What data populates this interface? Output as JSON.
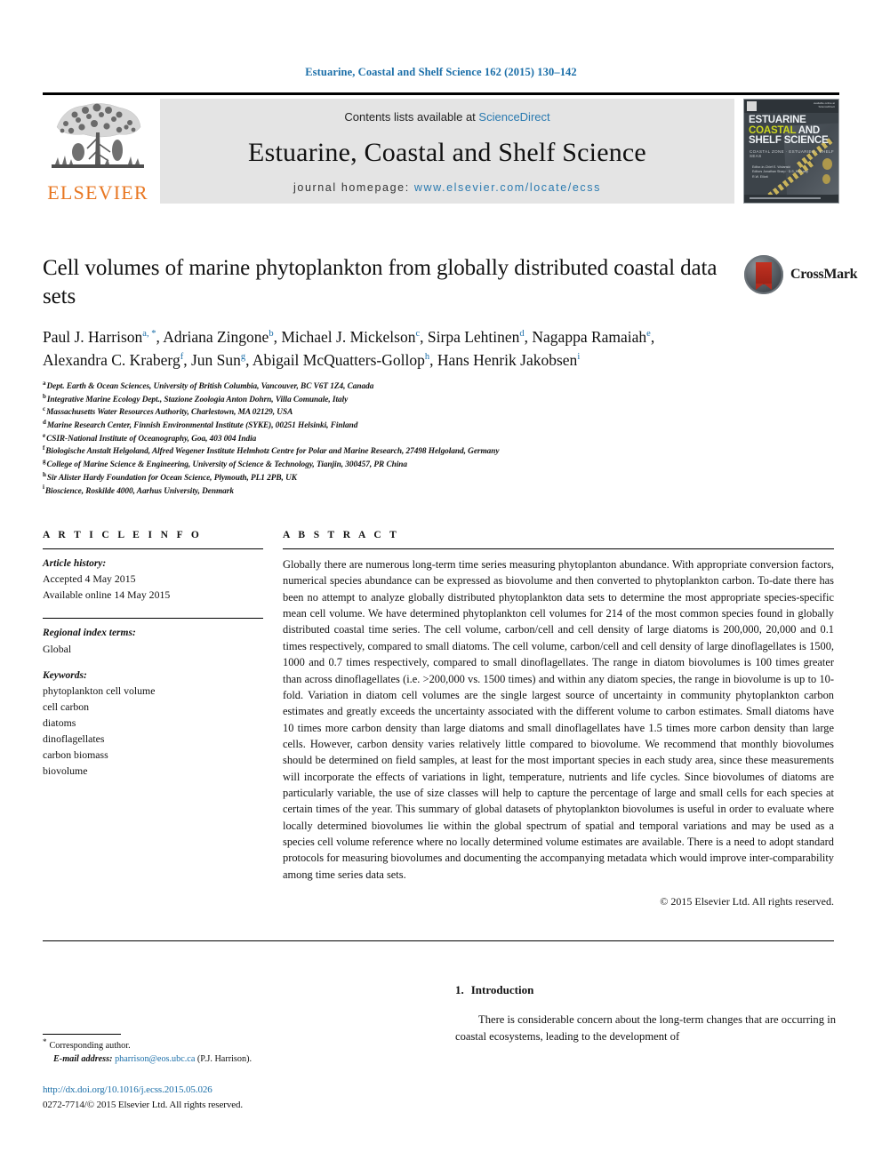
{
  "running_head": "Estuarine, Coastal and Shelf Science 162 (2015) 130–142",
  "masthead": {
    "contents_prefix": "Contents lists available at",
    "sciencedirect": "ScienceDirect",
    "journal_name": "Estuarine, Coastal and Shelf Science",
    "homepage_prefix": "journal homepage:",
    "homepage_url": "www.elsevier.com/locate/ecss",
    "publisher_logo_text": "ELSEVIER",
    "link_color": "#2a7ab0",
    "elsevier_orange": "#e87722",
    "cover": {
      "line1": "ESTUARINE",
      "line2a": "COASTAL",
      "line2b": "AND",
      "line3": "SHELF SCIENCE",
      "subtitle": "COASTAL ZONE · ESTUARIES · SHELF SEAS",
      "editors": "Editor-in-Chief  E. Wolanski\nEditors  Jonathan Sharp · D.S. McLusky\nR.W. Elliott",
      "top_note": "available online at\nScienceDirect"
    }
  },
  "article": {
    "title": "Cell volumes of marine phytoplankton from globally distributed coastal data sets",
    "authors_line1": "Paul J. Harrison ",
    "authors": [
      {
        "name": "Paul J. Harrison",
        "marks": "a, *",
        "sep": ", "
      },
      {
        "name": "Adriana Zingone",
        "marks": "b",
        "sep": ", "
      },
      {
        "name": "Michael J. Mickelson",
        "marks": "c",
        "sep": ", "
      },
      {
        "name": "Sirpa Lehtinen",
        "marks": "d",
        "sep": ","
      },
      {
        "name": "Nagappa Ramaiah",
        "marks": "e",
        "sep": ", "
      },
      {
        "name": "Alexandra C. Kraberg",
        "marks": "f",
        "sep": ", "
      },
      {
        "name": "Jun Sun",
        "marks": "g",
        "sep": ", "
      },
      {
        "name": "Abigail McQuatters-Gollop",
        "marks": "h",
        "sep": ","
      },
      {
        "name": "Hans Henrik Jakobsen",
        "marks": "i",
        "sep": ""
      }
    ],
    "crossmark_label": "CrossMark"
  },
  "affiliations": [
    {
      "mark": "a",
      "text": "Dept. Earth & Ocean Sciences, University of British Columbia, Vancouver, BC V6T 1Z4, Canada"
    },
    {
      "mark": "b",
      "text": "Integrative Marine Ecology Dept., Stazione Zoologia Anton Dohrn, Villa Comunale, Italy"
    },
    {
      "mark": "c",
      "text": "Massachusetts Water Resources Authority, Charlestown, MA 02129, USA"
    },
    {
      "mark": "d",
      "text": "Marine Research Center, Finnish Environmental Institute (SYKE), 00251 Helsinki, Finland"
    },
    {
      "mark": "e",
      "text": "CSIR-National Institute of Oceanography, Goa, 403 004 India"
    },
    {
      "mark": "f",
      "text": "Biologische Anstalt Helgoland, Alfred Wegener Institute Helmhotz Centre for Polar and Marine Research, 27498 Helgoland, Germany"
    },
    {
      "mark": "g",
      "text": "College of Marine Science & Engineering, University of Science & Technology, Tianjin, 300457, PR China"
    },
    {
      "mark": "h",
      "text": "Sir Alister Hardy Foundation for Ocean Science, Plymouth, PL1 2PB, UK"
    },
    {
      "mark": "i",
      "text": "Bioscience, Roskilde 4000, Aarhus University, Denmark"
    }
  ],
  "article_info": {
    "heading": "A R T I C L E   I N F O",
    "history_label": "Article history:",
    "history_lines": [
      "Accepted 4 May 2015",
      "Available online 14 May 2015"
    ],
    "regional_label": "Regional index terms:",
    "regional_values": [
      "Global"
    ],
    "keywords_label": "Keywords:",
    "keywords": [
      "phytoplankton cell volume",
      "cell carbon",
      "diatoms",
      "dinoflagellates",
      "carbon biomass",
      "biovolume"
    ]
  },
  "abstract": {
    "heading": "A B S T R A C T",
    "text": "Globally there are numerous long-term time series measuring phytoplanton abundance. With appropriate conversion factors, numerical species abundance can be expressed as biovolume and then converted to phytoplankton carbon. To-date there has been no attempt to analyze globally distributed phytoplankton data sets to determine the most appropriate species-specific mean cell volume. We have determined phytoplankton cell volumes for 214 of the most common species found in globally distributed coastal time series. The cell volume, carbon/cell and cell density of large diatoms is 200,000, 20,000 and 0.1 times respectively, compared to small diatoms. The cell volume, carbon/cell and cell density of large dinoflagellates is 1500, 1000 and 0.7 times respectively, compared to small dinoflagellates. The range in diatom biovolumes is 100 times greater than across dinoflagellates (i.e. >200,000 vs. 1500 times) and within any diatom species, the range in biovolume is up to 10-fold. Variation in diatom cell volumes are the single largest source of uncertainty in community phytoplankton carbon estimates and greatly exceeds the uncertainty associated with the different volume to carbon estimates. Small diatoms have 10 times more carbon density than large diatoms and small dinoflagellates have 1.5 times more carbon density than large cells. However, carbon density varies relatively little compared to biovolume. We recommend that monthly biovolumes should be determined on field samples, at least for the most important species in each study area, since these measurements will incorporate the effects of variations in light, temperature, nutrients and life cycles. Since biovolumes of diatoms are particularly variable, the use of size classes will help to capture the percentage of large and small cells for each species at certain times of the year. This summary of global datasets of phytoplankton biovolumes is useful in order to evaluate where locally determined biovolumes lie within the global spectrum of spatial and temporal variations and may be used as a species cell volume reference where no locally determined volume estimates are available. There is a need to adopt standard protocols for measuring biovolumes and documenting the accompanying metadata which would improve inter-comparability among time series data sets.",
    "copyright": "© 2015 Elsevier Ltd. All rights reserved."
  },
  "introduction": {
    "number": "1.",
    "heading": "Introduction",
    "paragraph": "There is considerable concern about the long-term changes that are occurring in coastal ecosystems, leading to the development of"
  },
  "footnote": {
    "corresponding": "Corresponding author.",
    "email_label": "E-mail address:",
    "email": "pharrison@eos.ubc.ca",
    "email_suffix": "(P.J. Harrison)."
  },
  "footer": {
    "doi": "http://dx.doi.org/10.1016/j.ecss.2015.05.026",
    "issn": "0272-7714/© 2015 Elsevier Ltd. All rights reserved."
  }
}
